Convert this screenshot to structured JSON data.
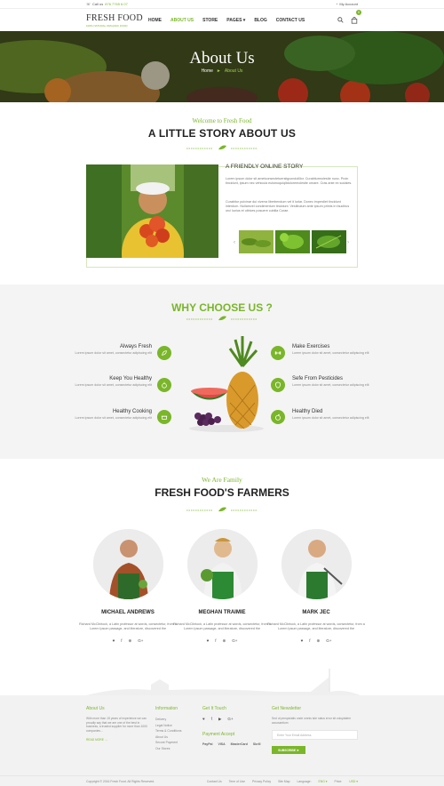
{
  "topbar": {
    "call_label": "Call us",
    "phone": "876 7765 6.07",
    "account": "My Account"
  },
  "header": {
    "logo": "FRESH FOOD",
    "logo_tagline": "100% NATURAL ORGANIC FOOD",
    "nav": [
      "HOME",
      "ABOUT US",
      "STORE",
      "PAGES",
      "BLOG",
      "CONTACT US"
    ],
    "active_nav": "ABOUT US",
    "cart_count": "0"
  },
  "hero": {
    "title": "About Us",
    "breadcrumb_home": "Home",
    "breadcrumb_sep": "►",
    "breadcrumb_current": "About Us"
  },
  "story": {
    "subtitle": "Welcome to Fresh Food",
    "title": "A LITTLE STORY ABOUT US",
    "heading": "A FRIENDLY ONLINE STORY",
    "p1": "Lorem ipsum dolor sit ametconsectetuersitgcondollllor. Curabiturmolestie nunc. Proin tincidunt, ipsum nec vehicula euismoquiqitdoloremolestie ornare. Cras ante ex sodales.",
    "p2": "Curabitur pulvinar dui viverra liberbendum vel it lurlar. Donec imperdiet tincidunt interdum. Nullamvel condimentum tincidunt. Vestibulum ante ipsum primis in faucibus orci luctus et ultrices posuere cubilia Curae."
  },
  "why": {
    "title": "WHY CHOOSE US ?",
    "features": [
      {
        "title": "Always Fresh",
        "desc": "Lorem ipsum dolor sit amet, consectetur adipiscing elit"
      },
      {
        "title": "Keep You Healthy",
        "desc": "Lorem ipsum dolor sit amet, consectetur adipiscing elit"
      },
      {
        "title": "Healthy Cooking",
        "desc": "Lorem ipsum dolor sit amet, consectetur adipiscing elit"
      },
      {
        "title": "Make Exercises",
        "desc": "Lorem ipsum dolor sit amet, consectetur adipiscing elit"
      },
      {
        "title": "Sefe From Pesticides",
        "desc": "Lorem ipsum dolor sit amet, consectetur adipiscing elit"
      },
      {
        "title": "Healthy Died",
        "desc": "Lorem ipsum dolor sit amet, consectetur adipiscing elit"
      }
    ]
  },
  "farmers": {
    "subtitle": "We Are Family",
    "title": "FRESH FOOD'S FARMERS",
    "people": [
      {
        "name": "MICHAEL ANDREWS",
        "desc": "Richard McClintock, a Latin professor at words, consectetur, from a Lorem Ipsum passage, and literature, discovered the"
      },
      {
        "name": "MEGHAN TRAIMIE",
        "desc": "Richard McClintock, a Latin professor at words, consectetur, from a Lorem Ipsum passage, and literature, discovered the"
      },
      {
        "name": "MARK JEC",
        "desc": "Richard McClintock, a Latin professor at words, consectetur, from a Lorem Ipsum passage, and literature, discovered the"
      }
    ],
    "social": [
      "♥",
      "f",
      "⊕",
      "G+"
    ]
  },
  "footer": {
    "about_head": "About Us",
    "about_text": "With more than 15 years of experience we can proudly say that we are one of the best in business, a trusted supplier for more than 1000 companies...",
    "read_more": "READ MORE →",
    "info_head": "Information",
    "info_links": [
      "Delivery",
      "Legal Notice",
      "Terms & Conditions",
      "About Us",
      "Secure Payment",
      "Our Stores"
    ],
    "touch_head": "Get It Touch",
    "touch_icons": [
      "♥",
      "f",
      "▶",
      "G+"
    ],
    "payment_head": "Payment Accept",
    "payments": [
      "PayPal",
      "VISA",
      "MasterCard",
      "Skrill"
    ],
    "newsletter_head": "Get Newsletter",
    "newsletter_text": "Sed ut perspiciatis unde omnis iste natus error sit voluptatem accusantium",
    "newsletter_placeholder": "Enter Your Email Address",
    "subscribe": "SUBSCRIBE ➤",
    "copyright": "Copyright © 2016 Fresh Food. All Rights Reserved.",
    "bottom_links": [
      "Contact Us",
      "Term of Use",
      "Privacy Policy",
      "Site Map"
    ],
    "language_label": "Language:",
    "language_value": "ENG ▾",
    "price_label": "Price:",
    "price_value": "USD ▾"
  },
  "colors": {
    "accent": "#7ab629"
  }
}
